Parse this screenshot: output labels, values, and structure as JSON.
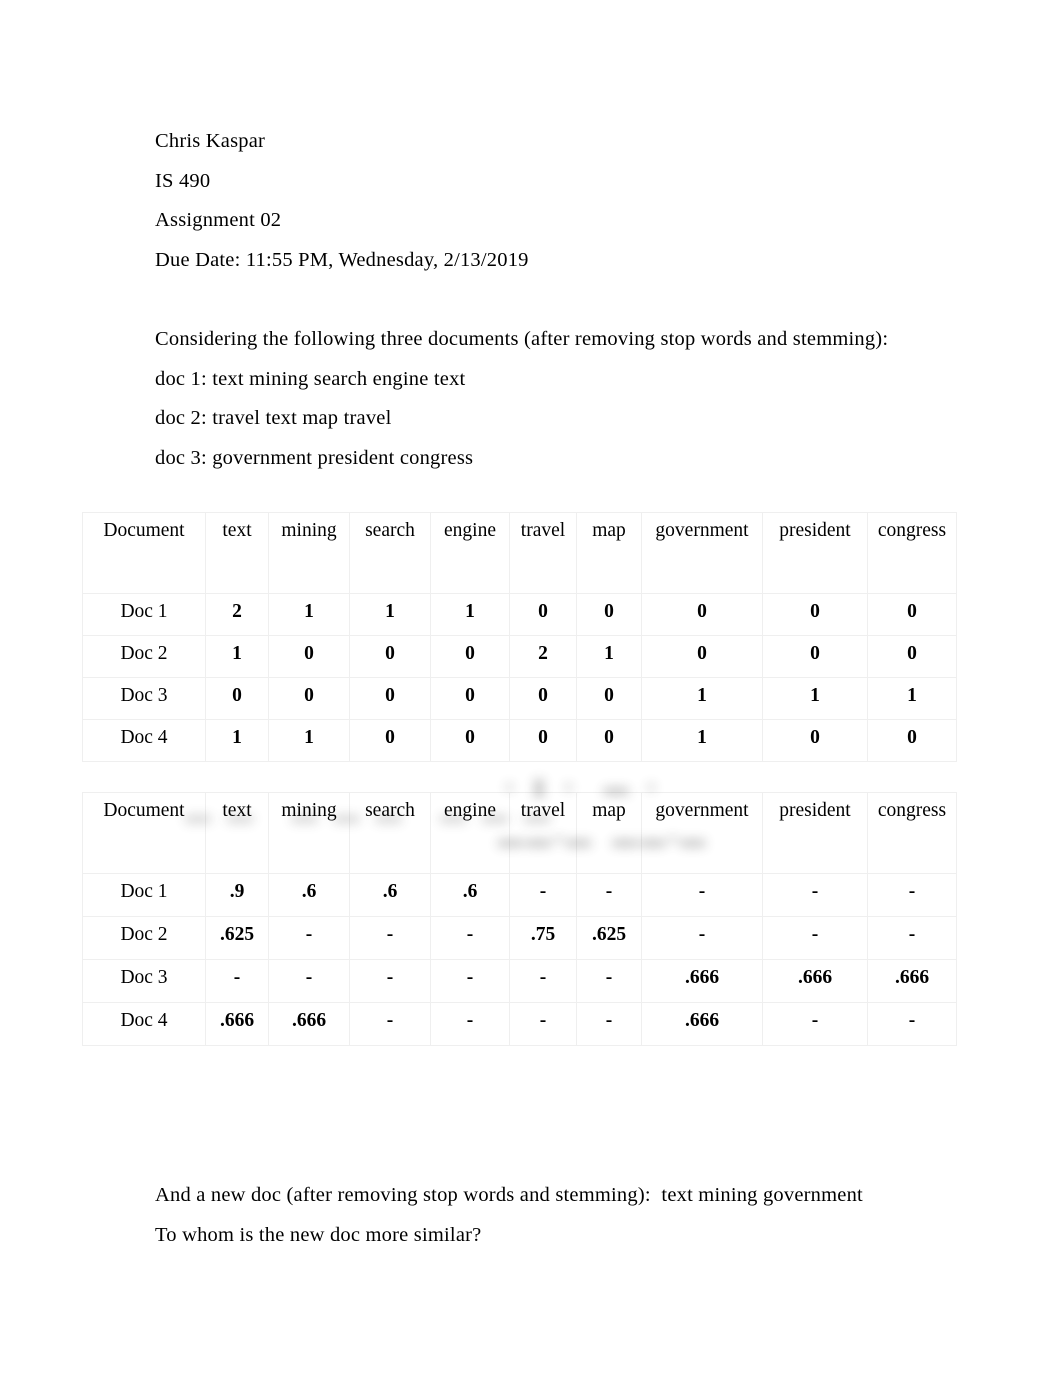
{
  "document": {
    "header_lines": [
      "Chris Kaspar",
      "IS 490",
      "Assignment 02",
      "Due Date: 11:55 PM, Wednesday, 2/13/2019"
    ],
    "intro_lines": [
      "Considering the following three documents (after removing stop words and stemming):",
      "doc 1: text mining search engine text",
      "doc 2: travel text map travel",
      "doc 3: government president congress"
    ],
    "closing_lines": [
      "And a new doc (after removing stop words and stemming):  text mining government",
      "To whom is the new doc more similar?"
    ]
  },
  "table_term_frequency": {
    "columns": [
      "Document",
      "text",
      "mining",
      "search",
      "engine",
      "travel",
      "map",
      "government",
      "president",
      "congress"
    ],
    "rows": [
      {
        "label": "Doc 1",
        "values": [
          "2",
          "1",
          "1",
          "1",
          "0",
          "0",
          "0",
          "0",
          "0"
        ]
      },
      {
        "label": "Doc 2",
        "values": [
          "1",
          "0",
          "0",
          "0",
          "2",
          "1",
          "0",
          "0",
          "0"
        ]
      },
      {
        "label": "Doc 3",
        "values": [
          "0",
          "0",
          "0",
          "0",
          "0",
          "0",
          "1",
          "1",
          "1"
        ]
      },
      {
        "label": "Doc 4",
        "values": [
          "1",
          "1",
          "0",
          "0",
          "0",
          "0",
          "1",
          "0",
          "0"
        ]
      }
    ]
  },
  "table_weights": {
    "columns": [
      "Document",
      "text",
      "mining",
      "search",
      "engine",
      "travel",
      "map",
      "government",
      "president",
      "congress"
    ],
    "rows": [
      {
        "label": "Doc 1",
        "values": [
          ".9",
          ".6",
          ".6",
          ".6",
          "-",
          "-",
          "-",
          "-",
          "-"
        ]
      },
      {
        "label": "Doc 2",
        "values": [
          ".625",
          "-",
          "-",
          "-",
          ".75",
          ".625",
          "-",
          "-",
          "-"
        ]
      },
      {
        "label": "Doc 3",
        "values": [
          "-",
          "-",
          "-",
          "-",
          "-",
          "-",
          ".666",
          ".666",
          ".666"
        ]
      },
      {
        "label": "Doc 4",
        "values": [
          ".666",
          ".666",
          "-",
          "-",
          "-",
          "-",
          ".666",
          "-",
          "-"
        ]
      }
    ]
  },
  "artifact": {
    "ghost_top": "▪ ▮ ▪  ▬ ▪",
    "ghost_bottom": "▬▬▪▬  ▬▬▪▬",
    "ghost_left": "▬▬ ▬▬▬ ▬▬▬"
  }
}
